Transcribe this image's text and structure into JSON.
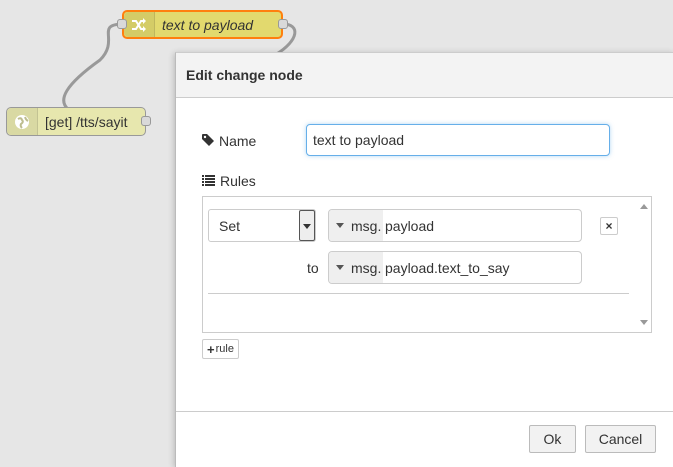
{
  "canvas": {
    "nodes": {
      "change_node_label": "text to payload",
      "http_node_label": "[get] /tts/sayit"
    }
  },
  "dialog": {
    "title": "Edit change node",
    "name_label": "Name",
    "name_value": "text to payload",
    "rules_label": "Rules",
    "rule": {
      "action": "Set",
      "target_type": "msg.",
      "target_value": "payload",
      "to_label": "to",
      "source_type": "msg.",
      "source_value": "payload.text_to_say",
      "delete_label": "×"
    },
    "add_rule_label": "rule",
    "ok_label": "Ok",
    "cancel_label": "Cancel"
  },
  "colors": {
    "change_node": "#e2d96e",
    "change_node_selected_border": "#ff7f0e",
    "http_node": "#e7e7ae",
    "canvas_bg": "#e6e6e6",
    "input_focus_border": "#66afe9"
  },
  "icons": {
    "change_node": "shuffle-icon",
    "http_node": "globe-icon",
    "name": "tag-icon",
    "rules": "list-icon"
  }
}
